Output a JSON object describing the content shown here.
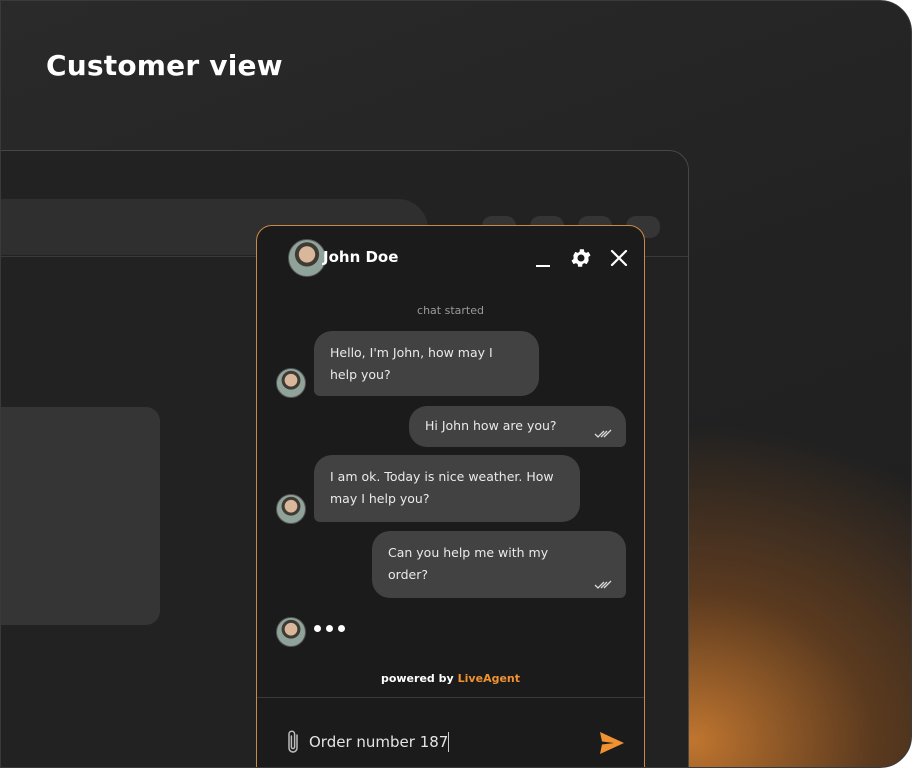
{
  "page": {
    "title": "Customer view"
  },
  "chat": {
    "agent_name": "John Doe",
    "status_text": "chat started",
    "messages": [
      {
        "from": "agent",
        "text": "Hello, I'm John, how may I help you?"
      },
      {
        "from": "visitor",
        "text": "Hi John how are you?"
      },
      {
        "from": "agent",
        "text": "I am ok. Today is nice weather. How may I help you?"
      },
      {
        "from": "visitor",
        "text": "Can you help me with my order?"
      }
    ],
    "powered_by_prefix": "powered by",
    "powered_by_brand": "LiveAgent",
    "input_value": "Order number 187",
    "icons": {
      "minimize": "minimize-icon",
      "settings": "gear-icon",
      "close": "close-icon",
      "attach": "paperclip-icon",
      "send": "send-icon",
      "read_receipt": "double-check-icon"
    }
  },
  "colors": {
    "accent": "#f09232",
    "bubble": "#424242",
    "widget_bg": "#1b1b1b"
  }
}
